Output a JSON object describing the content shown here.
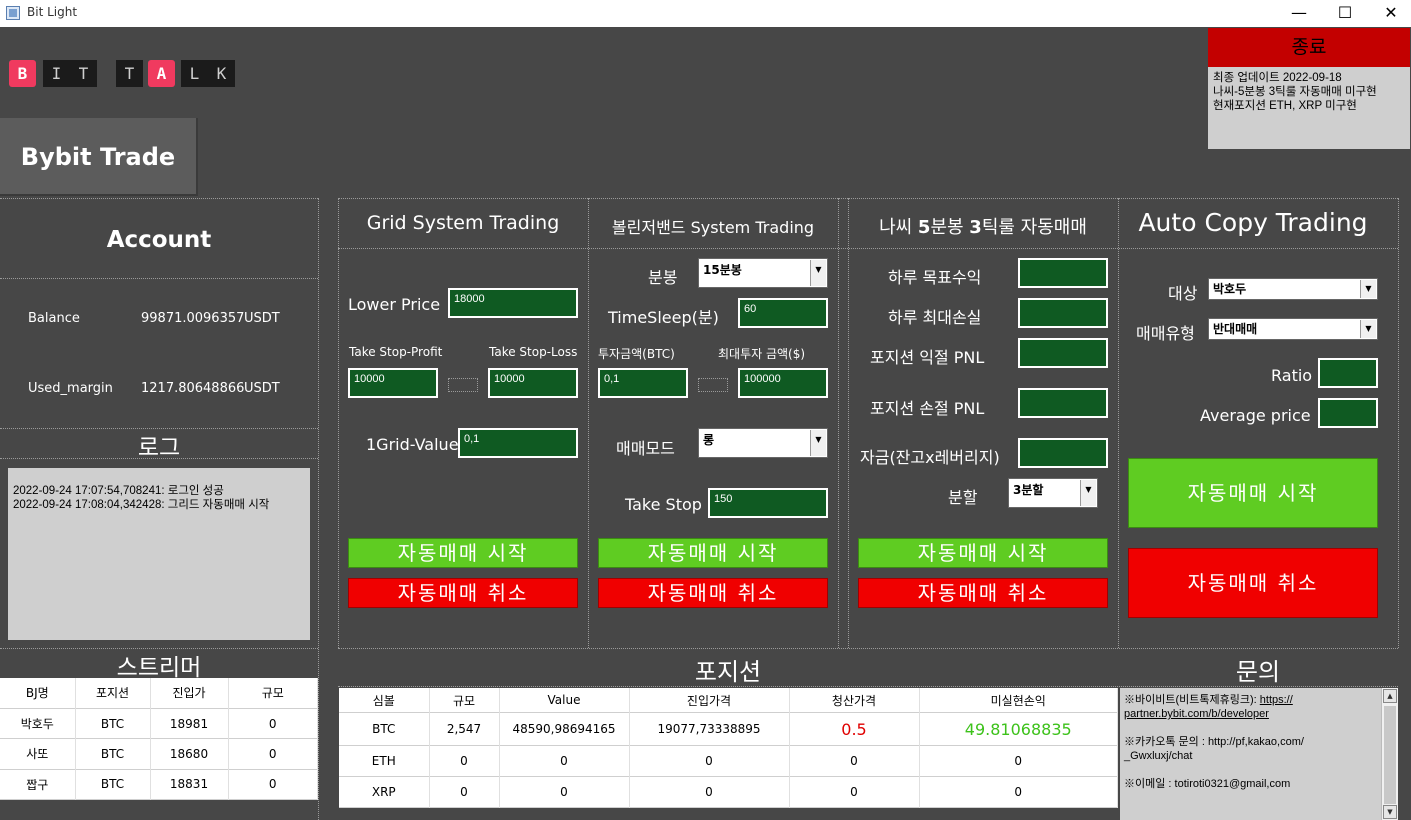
{
  "window": {
    "title": "Bit Light",
    "minimize": "—",
    "maximize": "☐",
    "close": "✕"
  },
  "logo": [
    "B",
    "I",
    "T",
    "T",
    "A",
    "L",
    "K"
  ],
  "nav": {
    "bybit_trade": "Bybit Trade"
  },
  "account": {
    "title": "Account",
    "balance_label": "Balance",
    "balance_value": "99871.0096357",
    "balance_unit": "USDT",
    "margin_label": "Used_margin",
    "margin_value": "1217.80648866",
    "margin_unit": "USDT"
  },
  "log": {
    "title": "로그",
    "lines": [
      "2022-09-24 17:07:54,708241: 로그인 성공",
      "2022-09-24 17:08:04,342428: 그리드 자동매매 시작"
    ]
  },
  "streamer": {
    "title": "스트리머",
    "headers": [
      "BJ명",
      "포지션",
      "진입가",
      "규모"
    ],
    "rows": [
      [
        "박호두",
        "BTC",
        "18981",
        "0"
      ],
      [
        "사또",
        "BTC",
        "18680",
        "0"
      ],
      [
        "짭구",
        "BTC",
        "18831",
        "0"
      ]
    ]
  },
  "grid": {
    "title": "Grid System Trading",
    "lower_price_label": "Lower Price",
    "lower_price": "18000",
    "tp_label": "Take Stop-Profit",
    "tp_value": "10000",
    "sl_label": "Take Stop-Loss",
    "sl_value": "10000",
    "grid_value_label": "1Grid-Value",
    "grid_value": "0,1",
    "start": "자동매매 시작",
    "cancel": "자동매매 취소"
  },
  "bollinger": {
    "title": "볼린저밴드 System Trading",
    "candle_label": "분봉",
    "candle_value": "15분봉",
    "sleep_label": "TimeSleep(분)",
    "sleep_value": "60",
    "invest_label": "투자금액(BTC)",
    "invest_value": "0,1",
    "max_invest_label": "최대투자 금액($)",
    "max_invest_value": "100000",
    "mode_label": "매매모드",
    "mode_value": "롱",
    "take_stop_label": "Take Stop",
    "take_stop_value": "150",
    "start": "자동매매 시작",
    "cancel": "자동매매 취소"
  },
  "nassi": {
    "title_pre": "나씨 ",
    "title_b1": "5",
    "title_mid": "분봉 ",
    "title_b2": "3",
    "title_post": "틱룰 자동매매",
    "target_label": "하루 목표수익",
    "maxloss_label": "하루 최대손실",
    "pnl_profit_label": "포지션 익절 PNL",
    "pnl_loss_label": "포지션 손절 PNL",
    "fund_label": "자금(잔고x레버리지)",
    "split_label": "분할",
    "split_value": "3분할",
    "start": "자동매매 시작",
    "cancel": "자동매매 취소"
  },
  "copy": {
    "title": "Auto Copy Trading",
    "target_label": "대상",
    "target_value": "박호두",
    "type_label": "매매유형",
    "type_value": "반대매매",
    "ratio_label": "Ratio",
    "avg_label": "Average price",
    "start": "자동매매 시작",
    "cancel": "자동매매 취소"
  },
  "positions": {
    "title": "포지션",
    "headers": [
      "심볼",
      "규모",
      "Value",
      "진입가격",
      "청산가격",
      "미실현손익"
    ],
    "rows": [
      [
        "BTC",
        "2,547",
        "48590,98694165",
        "19077,73338895",
        "0.5",
        "49.81068835"
      ],
      [
        "ETH",
        "0",
        "0",
        "0",
        "0",
        "0"
      ],
      [
        "XRP",
        "0",
        "0",
        "0",
        "0",
        "0"
      ]
    ]
  },
  "inquiry": {
    "title": "문의",
    "line1_pre": "※바이비트(비트톡제휴링크): ",
    "line1_link": "https://",
    "line1_link2": "partner.bybit.com/b/developer",
    "line2": "※카카오톡 문의 : http://pf,kakao,com/",
    "line2b": "_Gwxluxj/chat",
    "line3": "※이메일 : totiroti0321@gmail,com"
  },
  "close_button": "종료",
  "notice": [
    "최종 업데이트 2022-09-18",
    "나씨-5분봉 3틱룰 자동매매 미구현",
    "현재포지션 ETH, XRP 미구현"
  ],
  "colors": {
    "field_green": "#0f5a22",
    "btn_green": "#5fcc22",
    "btn_red": "#f00000",
    "liq_red": "#e00000",
    "pnl_green": "#3dc21b"
  }
}
